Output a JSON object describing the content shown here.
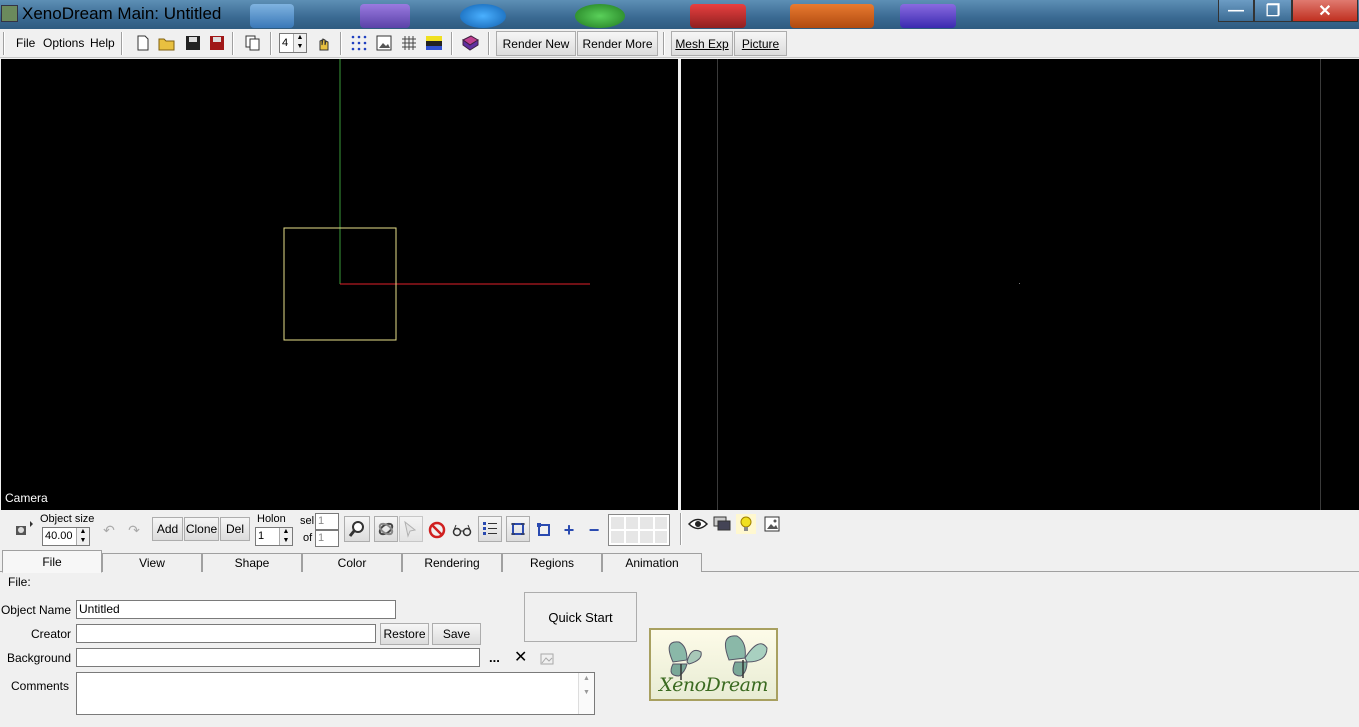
{
  "window": {
    "title": "XenoDream Main: Untitled",
    "minimize_glyph": "—",
    "maximize_glyph": "❐",
    "close_glyph": "✕"
  },
  "menu": {
    "file": "File",
    "options": "Options",
    "help": "Help"
  },
  "toolbar": {
    "count_value": "4",
    "render_new": "Render New",
    "render_more": "Render More",
    "mesh_exp": "Mesh Exp",
    "picture": "Picture"
  },
  "viewport": {
    "label": "Camera"
  },
  "object_tools": {
    "object_size_label": "Object size",
    "object_size_value": "40.00",
    "add": "Add",
    "clone": "Clone",
    "del": "Del",
    "holon_label": "Holon",
    "holon_value": "1",
    "sel_label": "sel",
    "sel_value": "1",
    "of_label": "of",
    "of_value": "1",
    "plus_glyph": "+",
    "minus_glyph": "−"
  },
  "tabs": [
    "File",
    "View",
    "Shape",
    "Color",
    "Rendering",
    "Regions",
    "Animation"
  ],
  "file_panel": {
    "section_label": "File:",
    "object_name_label": "Object Name",
    "object_name_value": "Untitled",
    "creator_label": "Creator",
    "creator_value": "",
    "restore": "Restore",
    "save": "Save",
    "background_label": "Background",
    "background_value": "",
    "browse_glyph": "...",
    "clear_glyph": "✕",
    "comments_label": "Comments",
    "comments_value": "",
    "quick_start": "Quick Start",
    "logo_text": "XenoDream"
  },
  "colors": {
    "viewport_bg": "#000000",
    "axis_y": "#3a9a3a",
    "axis_x": "#e0202a",
    "selection_box": "#e8e08a",
    "title_bar": "#3a6a92"
  }
}
